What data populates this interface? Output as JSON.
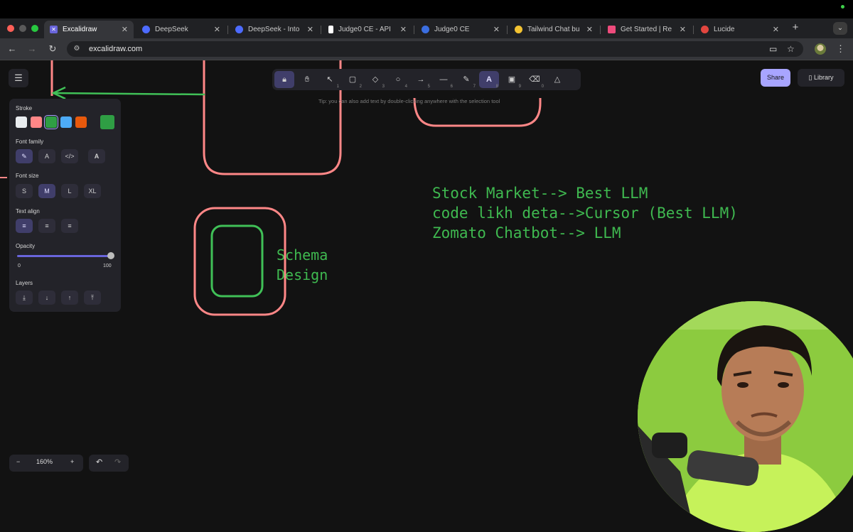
{
  "browser": {
    "tabs": [
      {
        "title": "Excalidraw",
        "active": true,
        "favicon_color": "#6965db"
      },
      {
        "title": "DeepSeek",
        "active": false,
        "favicon_color": "#4d6bfe"
      },
      {
        "title": "DeepSeek - Into",
        "active": false,
        "favicon_color": "#4d6bfe"
      },
      {
        "title": "Judge0 CE - API",
        "active": false,
        "favicon_color": "#ffffff"
      },
      {
        "title": "Judge0 CE",
        "active": false,
        "favicon_color": "#3b6ee0"
      },
      {
        "title": "Tailwind Chat bu",
        "active": false,
        "favicon_color": "#f3c332"
      },
      {
        "title": "Get Started | Re",
        "active": false,
        "favicon_color": "#ee4b7c"
      },
      {
        "title": "Lucide",
        "active": false,
        "favicon_color": "#e2463f"
      }
    ],
    "address": "excalidraw.com"
  },
  "excalidraw": {
    "toolbar": {
      "tools": [
        {
          "name": "lock-tool",
          "icon": "lock-icon",
          "key": ""
        },
        {
          "name": "hand-tool",
          "icon": "hand-icon",
          "key": ""
        },
        {
          "name": "selection-tool",
          "icon": "pointer-icon",
          "key": "1"
        },
        {
          "name": "rectangle-tool",
          "icon": "square-icon",
          "key": "2"
        },
        {
          "name": "diamond-tool",
          "icon": "diamond-icon",
          "key": "3"
        },
        {
          "name": "ellipse-tool",
          "icon": "circle-icon",
          "key": "4"
        },
        {
          "name": "arrow-tool",
          "icon": "arrow-icon",
          "key": "5"
        },
        {
          "name": "line-tool",
          "icon": "line-icon",
          "key": "6"
        },
        {
          "name": "draw-tool",
          "icon": "pencil-icon",
          "key": "7"
        },
        {
          "name": "text-tool",
          "icon": "text-icon",
          "key": "8"
        },
        {
          "name": "image-tool",
          "icon": "image-icon",
          "key": "9"
        },
        {
          "name": "eraser-tool",
          "icon": "eraser-icon",
          "key": "0"
        },
        {
          "name": "more-tools",
          "icon": "shapes-icon",
          "key": ""
        }
      ],
      "active_tool": "text-tool"
    },
    "tip": "Tip: you can also add text by double-clicking anywhere with the selection tool",
    "share_label": "Share",
    "library_label": "Library",
    "panel": {
      "stroke_label": "Stroke",
      "stroke_colors": [
        "#e9ecef",
        "#ff8787",
        "#2f9e44",
        "#4dabf7",
        "#e8590c"
      ],
      "stroke_selected_color": "#2f9e44",
      "font_family_label": "Font family",
      "font_size_label": "Font size",
      "font_sizes": [
        "S",
        "M",
        "L",
        "XL"
      ],
      "font_size_selected": "M",
      "text_align_label": "Text align",
      "opacity_label": "Opacity",
      "opacity_min": "0",
      "opacity_max": "100",
      "opacity_value": 100,
      "layers_label": "Layers"
    },
    "zoom_value": "160%",
    "canvas_text": {
      "schema_line1": "Schema",
      "schema_line2": "Design",
      "note_line1": "Stock Market--> Best LLM",
      "note_line2": "code likh deta-->Cursor (Best LLM)",
      "note_line3": "Zomato Chatbot--> LLM"
    },
    "colors": {
      "accent": "#a8a5ff",
      "shape_red": "#ff8787",
      "shape_green": "#40c057",
      "text_green": "#3fb950"
    }
  }
}
